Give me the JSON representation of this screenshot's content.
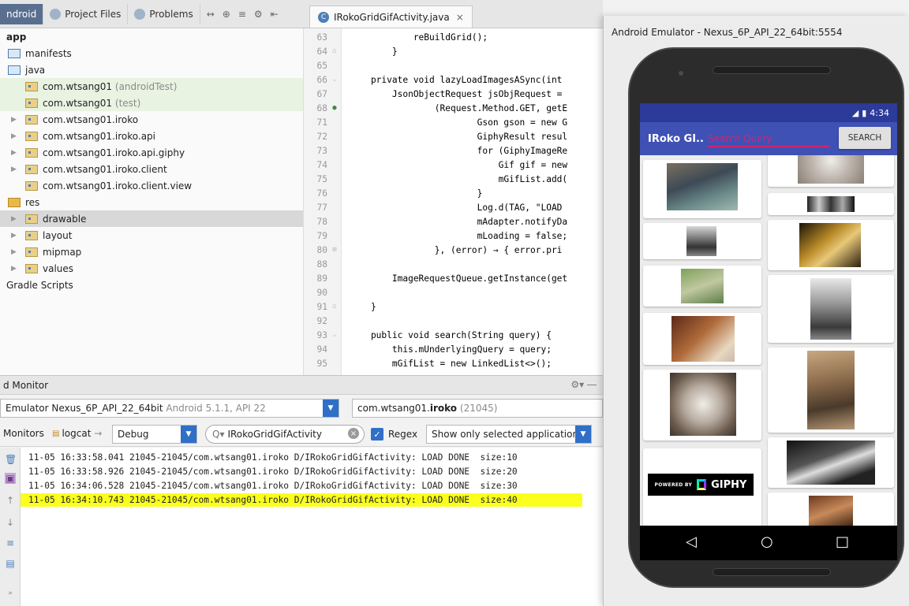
{
  "project_panel": {
    "tabs": [
      {
        "label": "ndroid",
        "active": true
      },
      {
        "label": "Project Files",
        "active": false
      },
      {
        "label": "Problems",
        "active": false
      }
    ],
    "tree": [
      {
        "label": "app",
        "suffix": "",
        "kind": "module"
      },
      {
        "label": "manifests",
        "suffix": "",
        "kind": "folder"
      },
      {
        "label": "java",
        "suffix": "",
        "kind": "folder"
      },
      {
        "label": "com.wtsang01",
        "suffix": "(androidTest)",
        "kind": "package"
      },
      {
        "label": "com.wtsang01",
        "suffix": "(test)",
        "kind": "package"
      },
      {
        "label": "com.wtsang01.iroko",
        "suffix": "",
        "kind": "package"
      },
      {
        "label": "com.wtsang01.iroko.api",
        "suffix": "",
        "kind": "package"
      },
      {
        "label": "com.wtsang01.iroko.api.giphy",
        "suffix": "",
        "kind": "package"
      },
      {
        "label": "com.wtsang01.iroko.client",
        "suffix": "",
        "kind": "package"
      },
      {
        "label": "com.wtsang01.iroko.client.view",
        "suffix": "",
        "kind": "package"
      },
      {
        "label": "res",
        "suffix": "",
        "kind": "res"
      },
      {
        "label": "drawable",
        "suffix": "",
        "kind": "package"
      },
      {
        "label": "layout",
        "suffix": "",
        "kind": "package"
      },
      {
        "label": "mipmap",
        "suffix": "",
        "kind": "package"
      },
      {
        "label": "values",
        "suffix": "",
        "kind": "package"
      },
      {
        "label": "Gradle Scripts",
        "suffix": "",
        "kind": "gradle"
      }
    ]
  },
  "editor": {
    "tab_label": "IRokoGridGifActivity.java",
    "tab_icon": "C",
    "close_glyph": "×",
    "lines": [
      {
        "num": "63",
        "code": "            reBuildGrid();"
      },
      {
        "num": "64",
        "code": "        }"
      },
      {
        "num": "65",
        "code": ""
      },
      {
        "num": "66",
        "code": "    private void lazyLoadImagesASync(int"
      },
      {
        "num": "67",
        "code": "        JsonObjectRequest jsObjRequest ="
      },
      {
        "num": "68",
        "code": "                (Request.Method.GET, getE"
      },
      {
        "num": "71",
        "code": "                        Gson gson = new G"
      },
      {
        "num": "72",
        "code": "                        GiphyResult resul"
      },
      {
        "num": "73",
        "code": "                        for (GiphyImageRe"
      },
      {
        "num": "74",
        "code": "                            Gif gif = new"
      },
      {
        "num": "75",
        "code": "                            mGifList.add("
      },
      {
        "num": "76",
        "code": "                        }"
      },
      {
        "num": "77",
        "code": "                        Log.d(TAG, \"LOAD"
      },
      {
        "num": "78",
        "code": "                        mAdapter.notifyDa"
      },
      {
        "num": "79",
        "code": "                        mLoading = false;"
      },
      {
        "num": "80",
        "code": "                }, (error) → { error.pri"
      },
      {
        "num": "88",
        "code": ""
      },
      {
        "num": "89",
        "code": "        ImageRequestQueue.getInstance(get"
      },
      {
        "num": "90",
        "code": ""
      },
      {
        "num": "91",
        "code": "    }"
      },
      {
        "num": "92",
        "code": ""
      },
      {
        "num": "93",
        "code": "    public void search(String query) {"
      },
      {
        "num": "94",
        "code": "        this.mUnderlyingQuery = query;"
      },
      {
        "num": "95",
        "code": "        mGifList = new LinkedList<>();"
      }
    ]
  },
  "monitor": {
    "title": "d Monitor",
    "device": {
      "emulator_label": "Emulator Nexus_6P_API_22_64bit",
      "emulator_detail": "Android 5.1.1, API 22",
      "process_prefix": "com.wtsang01.",
      "process_bold": "iroko",
      "process_pid": "(21045)"
    },
    "logcat": {
      "monitors_tab": "Monitors",
      "logcat_tab": "logcat",
      "level": "Debug",
      "search_value": "IRokoGridGifActivity",
      "regex_label": "Regex",
      "filter": "Show only selected application"
    },
    "lines": [
      {
        "text": "11-05 16:33:58.041 21045-21045/com.wtsang01.iroko D/IRokoGridGifActivity: LOAD DONE  size:10",
        "highlight": false
      },
      {
        "text": "11-05 16:33:58.926 21045-21045/com.wtsang01.iroko D/IRokoGridGifActivity: LOAD DONE  size:20",
        "highlight": false
      },
      {
        "text": "11-05 16:34:06.528 21045-21045/com.wtsang01.iroko D/IRokoGridGifActivity: LOAD DONE  size:30",
        "highlight": false
      },
      {
        "text": "11-05 16:34:10.743 21045-21045/com.wtsang01.iroko D/IRokoGridGifActivity: LOAD DONE  size:40",
        "highlight": true
      }
    ],
    "highlight_color": "#fbff1e"
  },
  "emulator": {
    "title": "Android Emulator - Nexus_6P_API_22_64bit:5554",
    "status_time": "4:34",
    "app_title": "IRoko GI...",
    "search_placeholder": "Search Query",
    "search_button": "SEARCH",
    "giphy_powered": "POWERED BY",
    "giphy_word": "GIPHY",
    "nav": {
      "back": "◁",
      "home": "○",
      "recents": "□"
    },
    "app_bar_color": "#3f51b5",
    "accent_color": "#e91e63"
  }
}
